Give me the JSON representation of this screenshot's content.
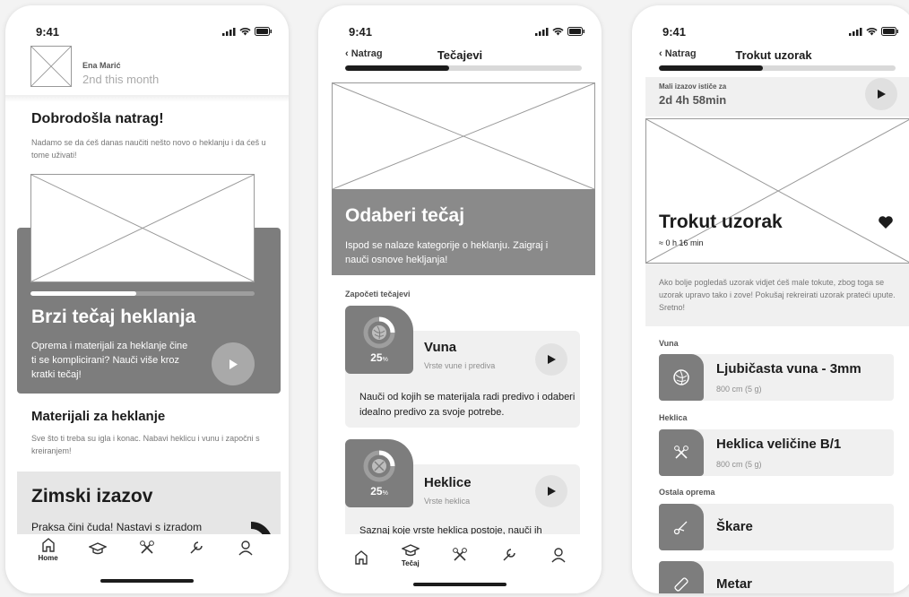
{
  "status": {
    "time": "9:41"
  },
  "screen1": {
    "user_name": "Ena Marić",
    "user_rank": "2nd this month",
    "welcome_title": "Dobrodošla natrag!",
    "welcome_text": "Nadamo se da ćeš danas naučiti nešto novo o heklanju i da ćeš u tome uživati!",
    "featured_progress": 0.47,
    "featured_title": "Brzi tečaj heklanja",
    "featured_text": "Oprema i materijali za heklanje čine ti se komplicirani? Nauči više kroz kratki tečaj!",
    "materials_title": "Materijali za heklanje",
    "materials_text": "Sve što ti treba su igla i konac. Nabavi heklicu i vunu i započni s kreiranjem!",
    "challenge_title": "Zimski izazov",
    "challenge_text": "Praksa čini čuda! Nastavi s izradom",
    "tabs": [
      {
        "name": "home",
        "label": "Home"
      },
      {
        "name": "courses",
        "label": ""
      },
      {
        "name": "tools",
        "label": ""
      },
      {
        "name": "equipment",
        "label": ""
      },
      {
        "name": "profile",
        "label": ""
      }
    ]
  },
  "screen2": {
    "back_label": "Natrag",
    "nav_title": "Tečajevi",
    "progress": 0.44,
    "hero_title": "Odaberi tečaj",
    "hero_text": "Ispod se nalaze kategorije o heklanju. Zaigraj i nauči osnove hekljanja!",
    "section_label": "Započeti tečajevi",
    "courses": [
      {
        "title": "Vuna",
        "subtitle": "Vrste vune i prediva",
        "percent": "25",
        "description": "Nauči od kojih se materijala radi predivo i odaberi idealno predivo za svoje potrebe."
      },
      {
        "title": "Heklice",
        "subtitle": "Vrste heklica",
        "percent": "25",
        "description": "Saznaj koje vrste heklica postoje, nauči ih"
      }
    ],
    "percent_sign": "%",
    "tab_active_label": "Tečaj"
  },
  "screen3": {
    "back_label": "Natrag",
    "nav_title": "Trokut uzorak",
    "progress": 0.44,
    "challenge_label": "Mali izazov ističe za",
    "challenge_timer": "2d 4h 58min",
    "hero_title": "Trokut uzorak",
    "hero_duration": "≈ 0 h 16 min",
    "description": "Ako bolje pogledaš uzorak vidjet ćeš male tokute, zbog toga se uzorak upravo tako i zove! Pokušaj rekreirati uzorak prateći upute. Sretno!",
    "sections": {
      "yarn_label": "Vuna",
      "yarn_item": "Ljubičasta vuna - 3mm",
      "yarn_meta": "800 cm (5 g)",
      "hook_label": "Heklica",
      "hook_item": "Heklica veličine B/1",
      "hook_meta": "800 cm (5 g)",
      "other_label": "Ostala oprema",
      "other_items": [
        "Škare",
        "Metar"
      ]
    }
  },
  "colors": {
    "dark": "#1c1c1c",
    "card_gray": "#7d7d7d",
    "light_gray": "#f0f0f0",
    "hero_gray": "#8a8a8a"
  }
}
